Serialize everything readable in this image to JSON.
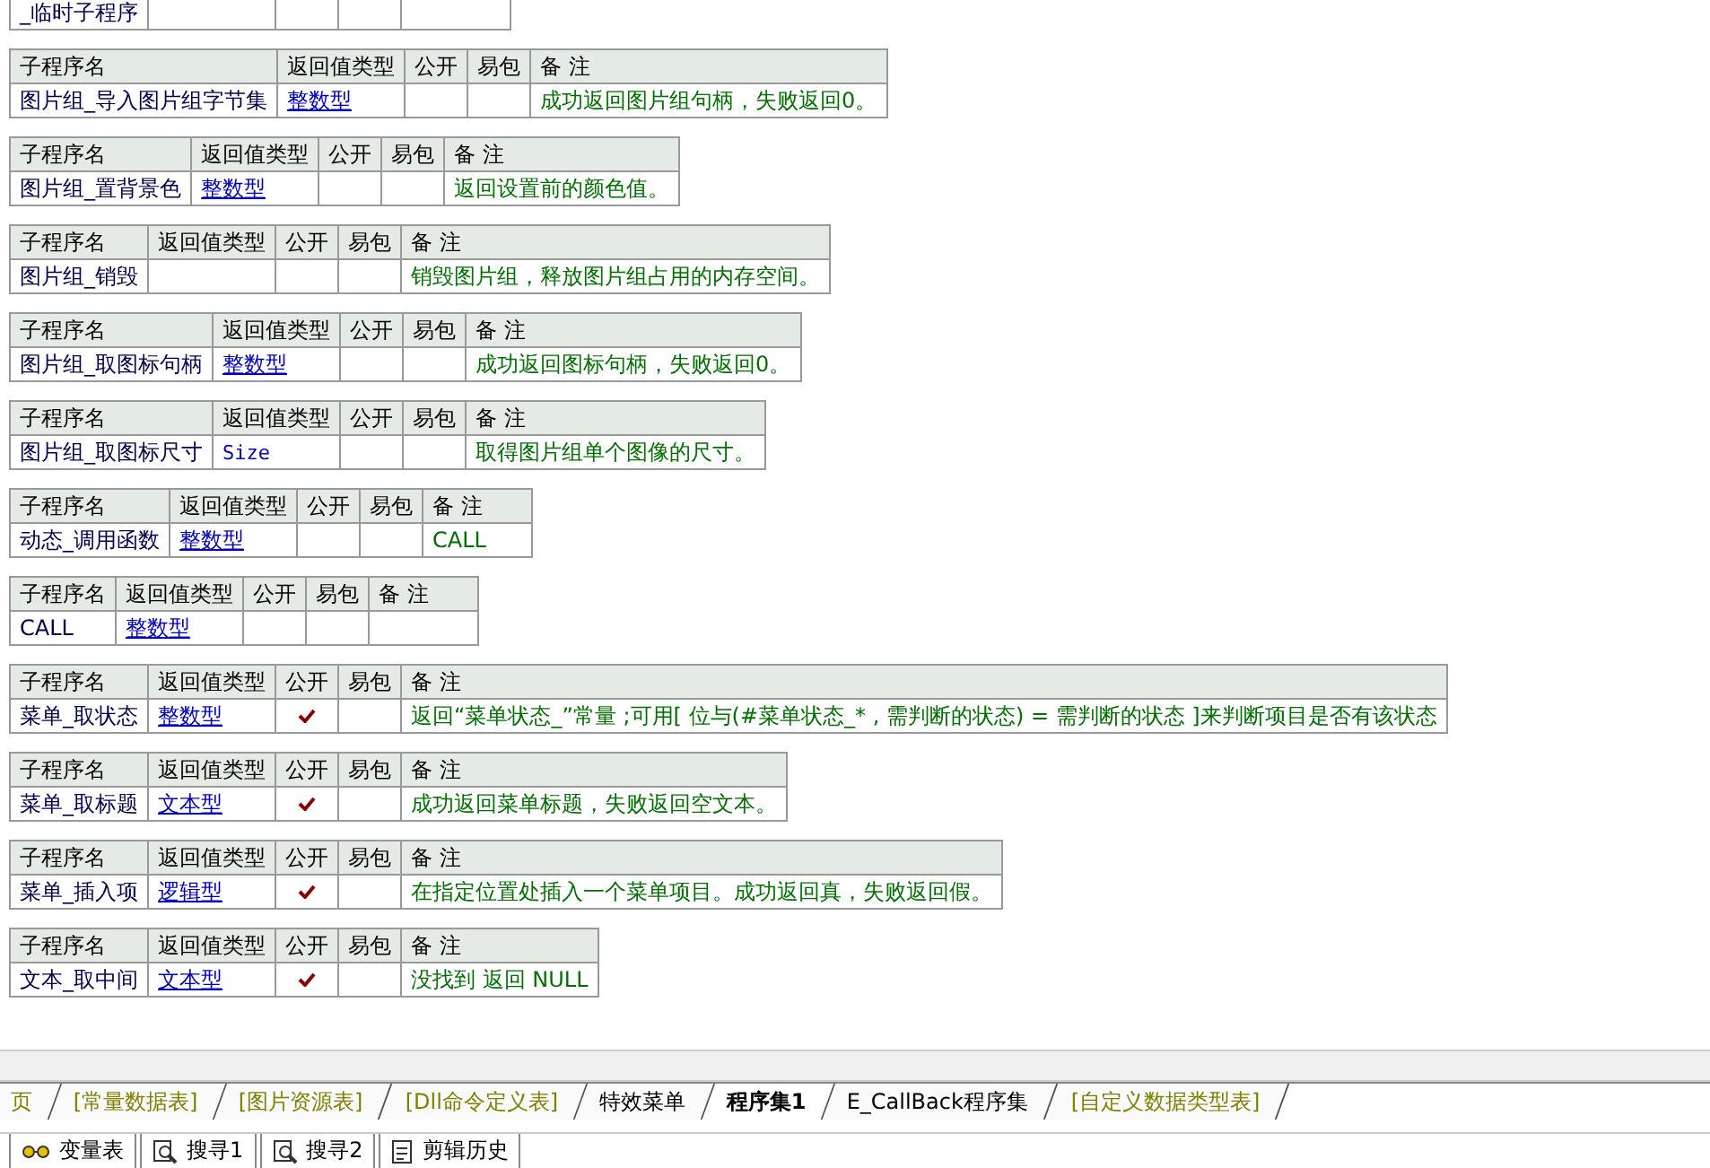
{
  "tables": [
    {
      "name": "_临时子程序",
      "public": false
    },
    {
      "columns": [
        "子程序名",
        "返回值类型",
        "公开",
        "易包",
        "备 注"
      ],
      "name": "图片组_导入图片组字节集",
      "type": {
        "text": "整数型",
        "kind": "builtin"
      },
      "public": false,
      "note": "成功返回图片组句柄，失败返回0。"
    },
    {
      "columns": [
        "子程序名",
        "返回值类型",
        "公开",
        "易包",
        "备 注"
      ],
      "name": "图片组_置背景色",
      "type": {
        "text": "整数型",
        "kind": "builtin"
      },
      "public": false,
      "note": "返回设置前的颜色值。"
    },
    {
      "columns": [
        "子程序名",
        "返回值类型",
        "公开",
        "易包",
        "备 注"
      ],
      "name": "图片组_销毁",
      "public": false,
      "note": "销毁图片组，释放图片组占用的内存空间。"
    },
    {
      "columns": [
        "子程序名",
        "返回值类型",
        "公开",
        "易包",
        "备 注"
      ],
      "name": "图片组_取图标句柄",
      "type": {
        "text": "整数型",
        "kind": "builtin"
      },
      "public": false,
      "note": "成功返回图标句柄，失败返回0。"
    },
    {
      "columns": [
        "子程序名",
        "返回值类型",
        "公开",
        "易包",
        "备 注"
      ],
      "name": "图片组_取图标尺寸",
      "type": {
        "text": "Size",
        "kind": "custom"
      },
      "public": false,
      "note": "取得图片组单个图像的尺寸。"
    },
    {
      "columns": [
        "子程序名",
        "返回值类型",
        "公开",
        "易包",
        "备 注"
      ],
      "name": "动态_调用函数",
      "type": {
        "text": "整数型",
        "kind": "builtin"
      },
      "public": false,
      "note": "CALL"
    },
    {
      "columns": [
        "子程序名",
        "返回值类型",
        "公开",
        "易包",
        "备 注"
      ],
      "name": "CALL",
      "type": {
        "text": "整数型",
        "kind": "builtin"
      },
      "public": false
    },
    {
      "columns": [
        "子程序名",
        "返回值类型",
        "公开",
        "易包",
        "备 注"
      ],
      "name": "菜单_取状态",
      "type": {
        "text": "整数型",
        "kind": "builtin"
      },
      "public": true,
      "note": "返回“菜单状态_”常量 ;可用[ 位与(#菜单状态_* , 需判断的状态) = 需判断的状态 ]来判断项目是否有该状态"
    },
    {
      "columns": [
        "子程序名",
        "返回值类型",
        "公开",
        "易包",
        "备 注"
      ],
      "name": "菜单_取标题",
      "type": {
        "text": "文本型",
        "kind": "builtin"
      },
      "public": true,
      "note": "成功返回菜单标题，失败返回空文本。"
    },
    {
      "columns": [
        "子程序名",
        "返回值类型",
        "公开",
        "易包",
        "备 注"
      ],
      "name": "菜单_插入项",
      "type": {
        "text": "逻辑型",
        "kind": "builtin"
      },
      "public": true,
      "note": "在指定位置处插入一个菜单项目。成功返回真，失败返回假。"
    },
    {
      "columns": [
        "子程序名",
        "返回值类型",
        "公开",
        "易包",
        "备 注"
      ],
      "name": "文本_取中间",
      "type": {
        "text": "文本型",
        "kind": "builtin"
      },
      "public": true,
      "note": "没找到 返回 NULL"
    }
  ],
  "tabs": [
    {
      "label": "页",
      "kind": "resource",
      "selected": false
    },
    {
      "label": "[常量数据表]",
      "kind": "resource",
      "selected": false
    },
    {
      "label": "[图片资源表]",
      "kind": "resource",
      "selected": false
    },
    {
      "label": "[Dll命令定义表]",
      "kind": "resource",
      "selected": false
    },
    {
      "label": "特效菜单",
      "kind": "code",
      "selected": false
    },
    {
      "label": "程序集1",
      "kind": "code",
      "selected": true
    },
    {
      "label": "E_CallBack程序集",
      "kind": "code",
      "selected": false
    },
    {
      "label": "[自定义数据类型表]",
      "kind": "resource",
      "selected": false
    }
  ],
  "panel_tabs": [
    {
      "label": "变量表"
    },
    {
      "label": "搜寻1"
    },
    {
      "label": "搜寻2"
    },
    {
      "label": "剪辑历史"
    }
  ]
}
